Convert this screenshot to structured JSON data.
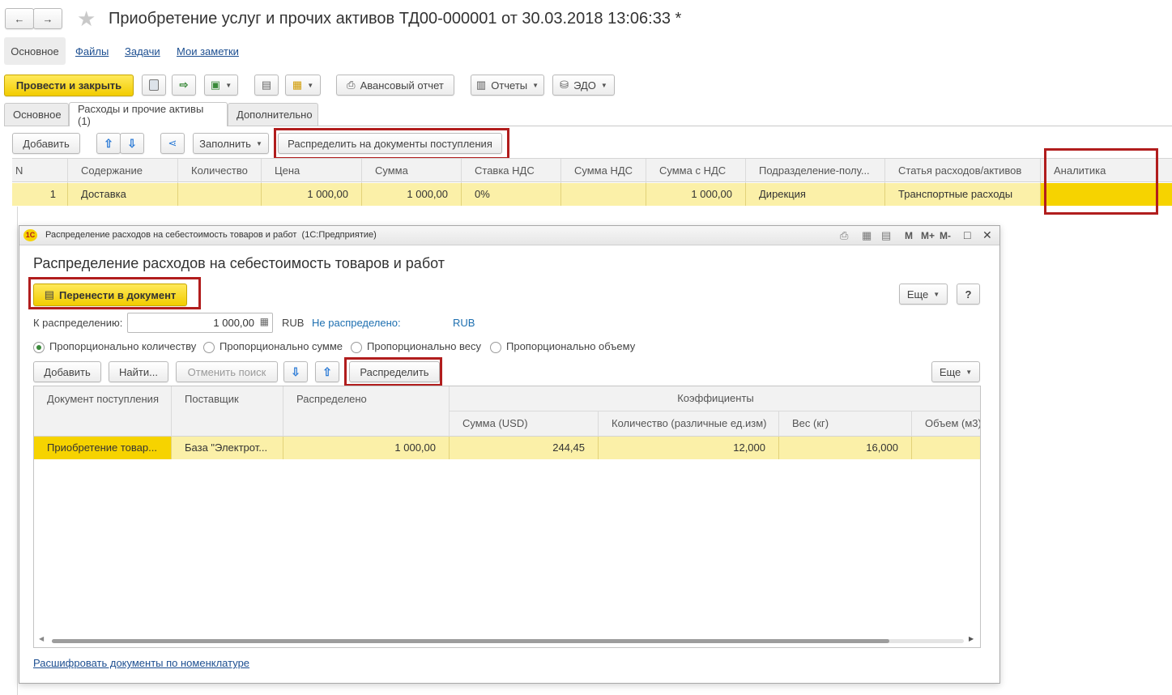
{
  "window": {
    "nav_back": "←",
    "nav_forward": "→",
    "star": "★",
    "title": "Приобретение услуг и прочих активов ТД00-000001 от 30.03.2018 13:06:33 *"
  },
  "section_links": [
    "Основное",
    "Файлы",
    "Задачи",
    "Мои заметки"
  ],
  "toolbar": {
    "post_close": "Провести и закрыть",
    "advance_report": "Авансовый отчет",
    "reports": "Отчеты",
    "edo": "ЭДО"
  },
  "tabs": [
    "Основное",
    "Расходы и прочие активы (1)",
    "Дополнительно"
  ],
  "table_toolbar": {
    "add": "Добавить",
    "fill": "Заполнить",
    "distribute_docs": "Распределить на документы поступления"
  },
  "main_table": {
    "columns": [
      "N",
      "Содержание",
      "Количество",
      "Цена",
      "Сумма",
      "Ставка НДС",
      "Сумма НДС",
      "Сумма с НДС",
      "Подразделение-полу...",
      "Статья расходов/активов",
      "Аналитика"
    ],
    "rows": [
      [
        "1",
        "Доставка",
        "",
        "1 000,00",
        "1 000,00",
        "0%",
        "",
        "1 000,00",
        "Дирекция",
        "Транспортные расходы",
        ""
      ]
    ]
  },
  "dialog": {
    "window_title": "Распределение расходов на себестоимость товаров и работ  (1С:Предприятие)",
    "app_badge": "1С",
    "title_controls": [
      "M",
      "M+",
      "M-",
      "□",
      "✕"
    ],
    "heading": "Распределение расходов на себестоимость товаров и работ",
    "transfer_button": "Перенести в документ",
    "more_label": "Еще",
    "help_label": "?",
    "to_distribute_label": "К распределению:",
    "to_distribute_value": "1 000,00",
    "currency": "RUB",
    "not_distributed_label": "Не распределено:",
    "not_distributed_currency": "RUB",
    "radios": [
      {
        "label": "Пропорционально количеству",
        "selected": true
      },
      {
        "label": "Пропорционально сумме",
        "selected": false
      },
      {
        "label": "Пропорционально весу",
        "selected": false
      },
      {
        "label": "Пропорционально объему",
        "selected": false
      }
    ],
    "add": "Добавить",
    "find": "Найти...",
    "cancel_search": "Отменить поиск",
    "distribute": "Распределить",
    "more2": "Еще",
    "table": {
      "col_doc": "Документ поступления",
      "col_supplier": "Поставщик",
      "col_distributed": "Распределено",
      "col_coeffs": "Коэффициенты",
      "sub_cols": [
        "Сумма (USD)",
        "Количество (различные ед.изм)",
        "Вес (кг)",
        "Объем (м3)"
      ],
      "rows": [
        [
          "Приобретение товар...",
          "База \"Электрот...",
          "1 000,00",
          "244,45",
          "12,000",
          "16,000",
          ""
        ]
      ]
    },
    "footer_link": "Расшифровать документы по номенклатуре"
  },
  "colors": {
    "highlight_row": "#fbf0a8",
    "yellow_button": "#f6d300",
    "red_frame": "#b11d1d",
    "link": "#1d4f91"
  }
}
